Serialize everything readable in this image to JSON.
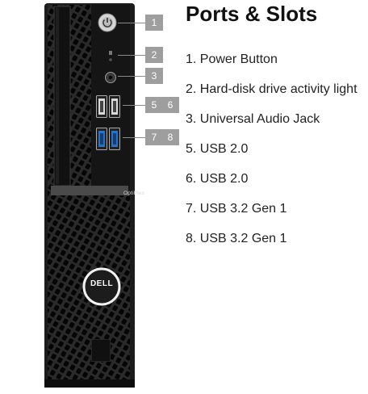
{
  "heading": "Ports & Slots",
  "brand": {
    "logo_text": "DELL",
    "model_badge": "OptiPlex"
  },
  "callouts": [
    "1",
    "2",
    "3",
    "5",
    "6",
    "7",
    "8"
  ],
  "ports": [
    {
      "label": "1. Power Button",
      "icon": "power-button-icon"
    },
    {
      "label": "2. Hard-disk drive activity light",
      "icon": "hdd-activity-light-icon"
    },
    {
      "label": "3. Universal Audio Jack",
      "icon": "audio-jack-icon"
    },
    {
      "label": "5. USB 2.0",
      "icon": "usb-2-port-icon"
    },
    {
      "label": "6. USB 2.0",
      "icon": "usb-2-port-icon"
    },
    {
      "label": "7. USB 3.2 Gen 1",
      "icon": "usb-3-port-icon"
    },
    {
      "label": "8. USB 3.2 Gen 1",
      "icon": "usb-3-port-icon"
    }
  ],
  "colors": {
    "chassis": "#1c1c1c",
    "callout_badge": "#9e9e9e",
    "usb3_blue": "#2a72c8"
  }
}
